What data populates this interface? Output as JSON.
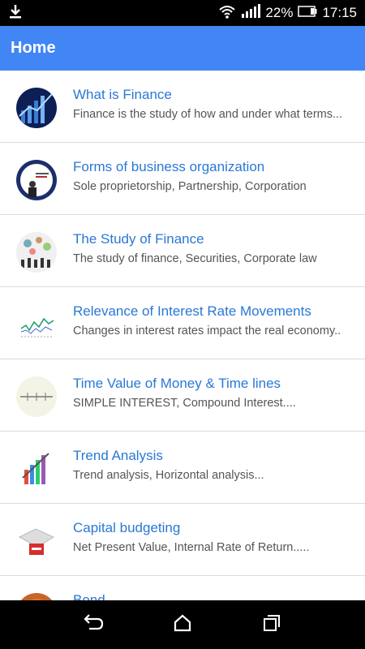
{
  "status_bar": {
    "download_icon": "download-icon",
    "wifi_icon": "wifi-icon",
    "signal_icon": "signal-icon",
    "battery_percent": "22%",
    "battery_icon": "battery-icon",
    "time": "17:15"
  },
  "app_bar": {
    "title": "Home"
  },
  "items": [
    {
      "title": "What is Finance",
      "subtitle": "Finance is the study of how and under what terms...",
      "icon": "finance-graph-thumbnail"
    },
    {
      "title": "Forms of business organization",
      "subtitle": "Sole proprietorship, Partnership, Corporation",
      "icon": "business-organization-thumbnail"
    },
    {
      "title": "The Study of Finance",
      "subtitle": "The study of finance, Securities, Corporate law",
      "icon": "study-finance-thumbnail"
    },
    {
      "title": "Relevance of Interest Rate Movements",
      "subtitle": "Changes in interest rates impact the real economy..",
      "icon": "interest-rate-chart-thumbnail"
    },
    {
      "title": "Time Value of Money & Time lines",
      "subtitle": "SIMPLE INTEREST, Compound Interest....",
      "icon": "timeline-thumbnail"
    },
    {
      "title": "Trend Analysis",
      "subtitle": "Trend analysis, Horizontal analysis...",
      "icon": "trend-chart-thumbnail"
    },
    {
      "title": "Capital budgeting",
      "subtitle": "Net Present Value, Internal Rate of Return.....",
      "icon": "puzzle-budget-thumbnail"
    },
    {
      "title": "Bond",
      "subtitle": "",
      "icon": "bond-thumbnail"
    }
  ],
  "nav_bar": {
    "back": "back-icon",
    "home": "home-icon",
    "recents": "recents-icon"
  },
  "colors": {
    "app_bar": "#4285f4",
    "title_text": "#2a78d4",
    "subtitle_text": "#555555"
  }
}
